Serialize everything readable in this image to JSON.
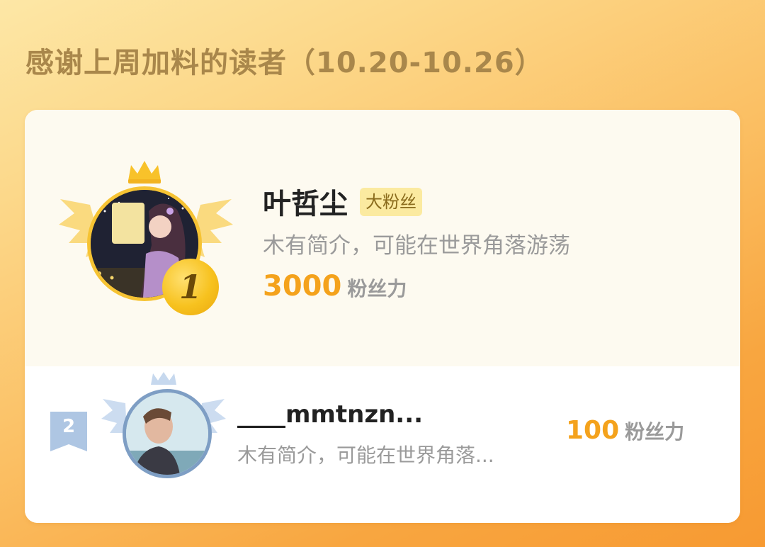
{
  "header": {
    "title": "感谢上周加料的读者（10.20-10.26）"
  },
  "leaderboard": {
    "first": {
      "rank": "1",
      "name": "叶哲尘",
      "tag": "大粉丝",
      "bio": "木有简介，可能在世界角落游荡",
      "score": "3000",
      "score_unit": "粉丝力"
    },
    "second": {
      "rank": "2",
      "name": "____mmtnzn...",
      "bio": "木有简介，可能在世界角落...",
      "score": "100",
      "score_unit": "粉丝力"
    }
  },
  "colors": {
    "gold": "#f6c333",
    "score": "#f4a21c",
    "silver": "#7e9ec4",
    "title": "#a9874b"
  }
}
